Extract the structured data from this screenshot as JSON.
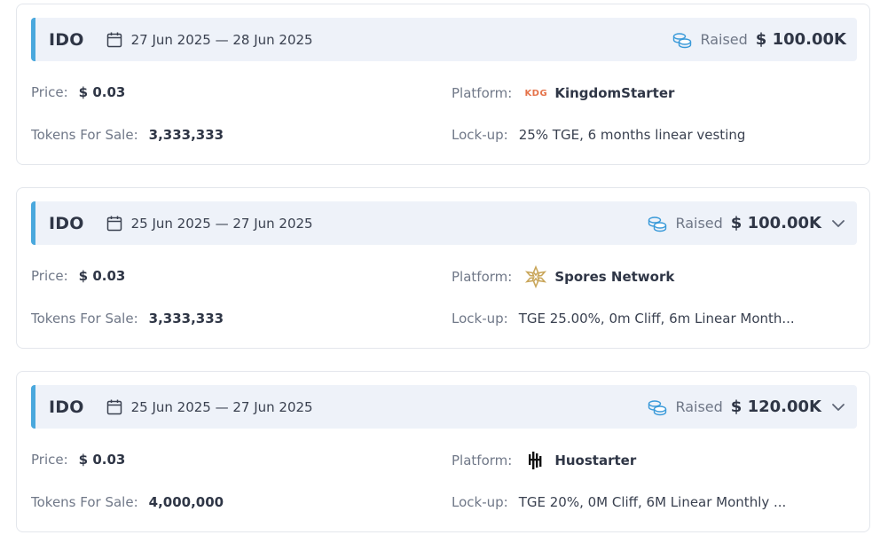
{
  "sales": [
    {
      "type": "IDO",
      "dates": "27 Jun 2025 — 28 Jun 2025",
      "raised_label": "Raised",
      "raised_value": "$ 100.00K",
      "price_label": "Price:",
      "price_value": "$ 0.03",
      "tokens_label": "Tokens For Sale:",
      "tokens_value": "3,333,333",
      "platform_label": "Platform:",
      "platform_logo_text": "KDG",
      "platform_name": "KingdomStarter",
      "lockup_label": "Lock-up:",
      "lockup_value": "25% TGE, 6 months linear vesting"
    },
    {
      "type": "IDO",
      "dates": "25 Jun 2025 — 27 Jun 2025",
      "raised_label": "Raised",
      "raised_value": "$ 100.00K",
      "price_label": "Price:",
      "price_value": "$ 0.03",
      "tokens_label": "Tokens For Sale:",
      "tokens_value": "3,333,333",
      "platform_label": "Platform:",
      "platform_name": "Spores Network",
      "lockup_label": "Lock-up:",
      "lockup_value": "TGE 25.00%, 0m Cliff, 6m Linear Month..."
    },
    {
      "type": "IDO",
      "dates": "25 Jun 2025 — 27 Jun 2025",
      "raised_label": "Raised",
      "raised_value": "$ 120.00K",
      "price_label": "Price:",
      "price_value": "$ 0.03",
      "tokens_label": "Tokens For Sale:",
      "tokens_value": "4,000,000",
      "platform_label": "Platform:",
      "platform_name": "Huostarter",
      "lockup_label": "Lock-up:",
      "lockup_value": "TGE 20%, 0M Cliff, 6M Linear Monthly ..."
    }
  ],
  "icons": {
    "calendar": "calendar-icon",
    "coins": "coins-icon",
    "chevron": "chevron-down-icon"
  },
  "colors": {
    "accent": "#4aa8dd",
    "header_bg": "#eef2f9",
    "kdg_logo": "#e5734a",
    "spores_logo": "#c9a65a"
  }
}
